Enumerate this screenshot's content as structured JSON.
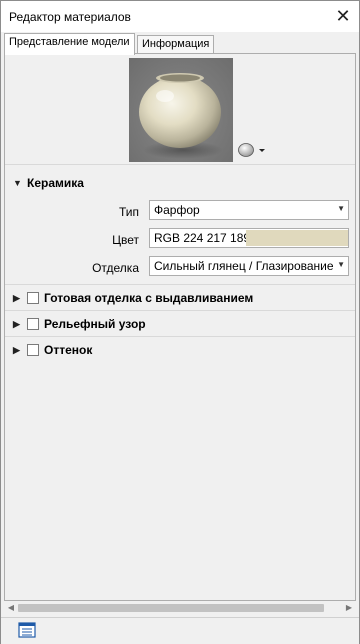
{
  "window": {
    "title": "Редактор материалов",
    "close_glyph": "✕"
  },
  "tabs": [
    {
      "label": "Представление модели",
      "active": true
    },
    {
      "label": "Информация",
      "active": false
    }
  ],
  "preview": {
    "thumbnail": "ceramic-vase-preview",
    "shape_selector_icon": "sphere-icon",
    "dropdown_glyph": "▾"
  },
  "sections": {
    "ceramics": {
      "label": "Керамика",
      "expanded": true,
      "expand_glyph": "▼",
      "type": {
        "label": "Тип",
        "value": "Фарфор"
      },
      "color": {
        "label": "Цвет",
        "value": "RGB 224 217 189",
        "hex": "#e0d9bd"
      },
      "finish": {
        "label": "Отделка",
        "value": "Сильный глянец / Глазирование"
      }
    },
    "relief_finish": {
      "label": "Готовая отделка с выдавливанием",
      "expanded": false,
      "checked": false,
      "expand_glyph": "▶"
    },
    "relief_pattern": {
      "label": "Рельефный узор",
      "expanded": false,
      "checked": false,
      "expand_glyph": "▶"
    },
    "tint": {
      "label": "Оттенок",
      "expanded": false,
      "checked": false,
      "expand_glyph": "▶"
    }
  },
  "scrollbar": {
    "left_glyph": "◀",
    "right_glyph": "▶"
  },
  "bottom": {
    "icon": "material-list-icon"
  },
  "colors": {
    "accent": "#1e5aa8",
    "panel_bg": "#f0f0f0",
    "border": "#adadad"
  }
}
